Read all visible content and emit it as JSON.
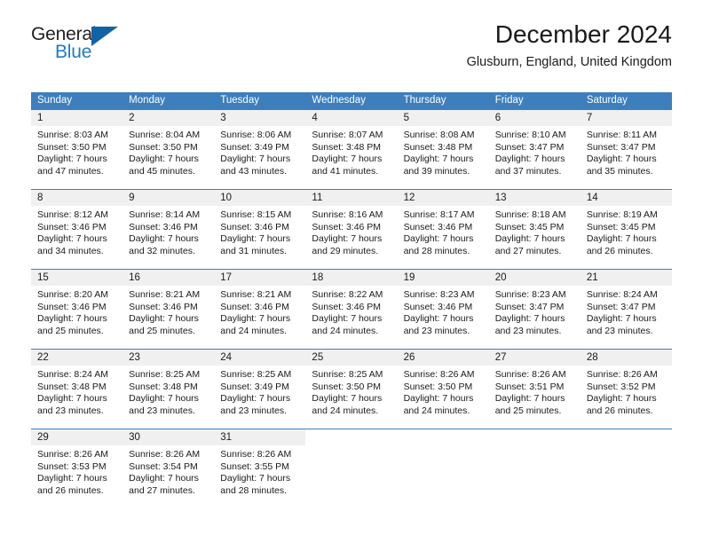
{
  "brand": {
    "name_part1": "General",
    "name_part2": "Blue"
  },
  "header": {
    "title": "December 2024",
    "location": "Glusburn, England, United Kingdom"
  },
  "colors": {
    "header_blue": "#3d7ebd",
    "logo_blue": "#1f7bc4",
    "logo_triangle": "#1163a8",
    "daynum_background": "#f0f0f0"
  },
  "weekdays": [
    "Sunday",
    "Monday",
    "Tuesday",
    "Wednesday",
    "Thursday",
    "Friday",
    "Saturday"
  ],
  "weeks": [
    [
      {
        "day": "1",
        "sunrise": "Sunrise: 8:03 AM",
        "sunset": "Sunset: 3:50 PM",
        "daylight1": "Daylight: 7 hours",
        "daylight2": "and 47 minutes."
      },
      {
        "day": "2",
        "sunrise": "Sunrise: 8:04 AM",
        "sunset": "Sunset: 3:50 PM",
        "daylight1": "Daylight: 7 hours",
        "daylight2": "and 45 minutes."
      },
      {
        "day": "3",
        "sunrise": "Sunrise: 8:06 AM",
        "sunset": "Sunset: 3:49 PM",
        "daylight1": "Daylight: 7 hours",
        "daylight2": "and 43 minutes."
      },
      {
        "day": "4",
        "sunrise": "Sunrise: 8:07 AM",
        "sunset": "Sunset: 3:48 PM",
        "daylight1": "Daylight: 7 hours",
        "daylight2": "and 41 minutes."
      },
      {
        "day": "5",
        "sunrise": "Sunrise: 8:08 AM",
        "sunset": "Sunset: 3:48 PM",
        "daylight1": "Daylight: 7 hours",
        "daylight2": "and 39 minutes."
      },
      {
        "day": "6",
        "sunrise": "Sunrise: 8:10 AM",
        "sunset": "Sunset: 3:47 PM",
        "daylight1": "Daylight: 7 hours",
        "daylight2": "and 37 minutes."
      },
      {
        "day": "7",
        "sunrise": "Sunrise: 8:11 AM",
        "sunset": "Sunset: 3:47 PM",
        "daylight1": "Daylight: 7 hours",
        "daylight2": "and 35 minutes."
      }
    ],
    [
      {
        "day": "8",
        "sunrise": "Sunrise: 8:12 AM",
        "sunset": "Sunset: 3:46 PM",
        "daylight1": "Daylight: 7 hours",
        "daylight2": "and 34 minutes."
      },
      {
        "day": "9",
        "sunrise": "Sunrise: 8:14 AM",
        "sunset": "Sunset: 3:46 PM",
        "daylight1": "Daylight: 7 hours",
        "daylight2": "and 32 minutes."
      },
      {
        "day": "10",
        "sunrise": "Sunrise: 8:15 AM",
        "sunset": "Sunset: 3:46 PM",
        "daylight1": "Daylight: 7 hours",
        "daylight2": "and 31 minutes."
      },
      {
        "day": "11",
        "sunrise": "Sunrise: 8:16 AM",
        "sunset": "Sunset: 3:46 PM",
        "daylight1": "Daylight: 7 hours",
        "daylight2": "and 29 minutes."
      },
      {
        "day": "12",
        "sunrise": "Sunrise: 8:17 AM",
        "sunset": "Sunset: 3:46 PM",
        "daylight1": "Daylight: 7 hours",
        "daylight2": "and 28 minutes."
      },
      {
        "day": "13",
        "sunrise": "Sunrise: 8:18 AM",
        "sunset": "Sunset: 3:45 PM",
        "daylight1": "Daylight: 7 hours",
        "daylight2": "and 27 minutes."
      },
      {
        "day": "14",
        "sunrise": "Sunrise: 8:19 AM",
        "sunset": "Sunset: 3:45 PM",
        "daylight1": "Daylight: 7 hours",
        "daylight2": "and 26 minutes."
      }
    ],
    [
      {
        "day": "15",
        "sunrise": "Sunrise: 8:20 AM",
        "sunset": "Sunset: 3:46 PM",
        "daylight1": "Daylight: 7 hours",
        "daylight2": "and 25 minutes."
      },
      {
        "day": "16",
        "sunrise": "Sunrise: 8:21 AM",
        "sunset": "Sunset: 3:46 PM",
        "daylight1": "Daylight: 7 hours",
        "daylight2": "and 25 minutes."
      },
      {
        "day": "17",
        "sunrise": "Sunrise: 8:21 AM",
        "sunset": "Sunset: 3:46 PM",
        "daylight1": "Daylight: 7 hours",
        "daylight2": "and 24 minutes."
      },
      {
        "day": "18",
        "sunrise": "Sunrise: 8:22 AM",
        "sunset": "Sunset: 3:46 PM",
        "daylight1": "Daylight: 7 hours",
        "daylight2": "and 24 minutes."
      },
      {
        "day": "19",
        "sunrise": "Sunrise: 8:23 AM",
        "sunset": "Sunset: 3:46 PM",
        "daylight1": "Daylight: 7 hours",
        "daylight2": "and 23 minutes."
      },
      {
        "day": "20",
        "sunrise": "Sunrise: 8:23 AM",
        "sunset": "Sunset: 3:47 PM",
        "daylight1": "Daylight: 7 hours",
        "daylight2": "and 23 minutes."
      },
      {
        "day": "21",
        "sunrise": "Sunrise: 8:24 AM",
        "sunset": "Sunset: 3:47 PM",
        "daylight1": "Daylight: 7 hours",
        "daylight2": "and 23 minutes."
      }
    ],
    [
      {
        "day": "22",
        "sunrise": "Sunrise: 8:24 AM",
        "sunset": "Sunset: 3:48 PM",
        "daylight1": "Daylight: 7 hours",
        "daylight2": "and 23 minutes."
      },
      {
        "day": "23",
        "sunrise": "Sunrise: 8:25 AM",
        "sunset": "Sunset: 3:48 PM",
        "daylight1": "Daylight: 7 hours",
        "daylight2": "and 23 minutes."
      },
      {
        "day": "24",
        "sunrise": "Sunrise: 8:25 AM",
        "sunset": "Sunset: 3:49 PM",
        "daylight1": "Daylight: 7 hours",
        "daylight2": "and 23 minutes."
      },
      {
        "day": "25",
        "sunrise": "Sunrise: 8:25 AM",
        "sunset": "Sunset: 3:50 PM",
        "daylight1": "Daylight: 7 hours",
        "daylight2": "and 24 minutes."
      },
      {
        "day": "26",
        "sunrise": "Sunrise: 8:26 AM",
        "sunset": "Sunset: 3:50 PM",
        "daylight1": "Daylight: 7 hours",
        "daylight2": "and 24 minutes."
      },
      {
        "day": "27",
        "sunrise": "Sunrise: 8:26 AM",
        "sunset": "Sunset: 3:51 PM",
        "daylight1": "Daylight: 7 hours",
        "daylight2": "and 25 minutes."
      },
      {
        "day": "28",
        "sunrise": "Sunrise: 8:26 AM",
        "sunset": "Sunset: 3:52 PM",
        "daylight1": "Daylight: 7 hours",
        "daylight2": "and 26 minutes."
      }
    ],
    [
      {
        "day": "29",
        "sunrise": "Sunrise: 8:26 AM",
        "sunset": "Sunset: 3:53 PM",
        "daylight1": "Daylight: 7 hours",
        "daylight2": "and 26 minutes."
      },
      {
        "day": "30",
        "sunrise": "Sunrise: 8:26 AM",
        "sunset": "Sunset: 3:54 PM",
        "daylight1": "Daylight: 7 hours",
        "daylight2": "and 27 minutes."
      },
      {
        "day": "31",
        "sunrise": "Sunrise: 8:26 AM",
        "sunset": "Sunset: 3:55 PM",
        "daylight1": "Daylight: 7 hours",
        "daylight2": "and 28 minutes."
      },
      {
        "day": "",
        "sunrise": "",
        "sunset": "",
        "daylight1": "",
        "daylight2": ""
      },
      {
        "day": "",
        "sunrise": "",
        "sunset": "",
        "daylight1": "",
        "daylight2": ""
      },
      {
        "day": "",
        "sunrise": "",
        "sunset": "",
        "daylight1": "",
        "daylight2": ""
      },
      {
        "day": "",
        "sunrise": "",
        "sunset": "",
        "daylight1": "",
        "daylight2": ""
      }
    ]
  ]
}
